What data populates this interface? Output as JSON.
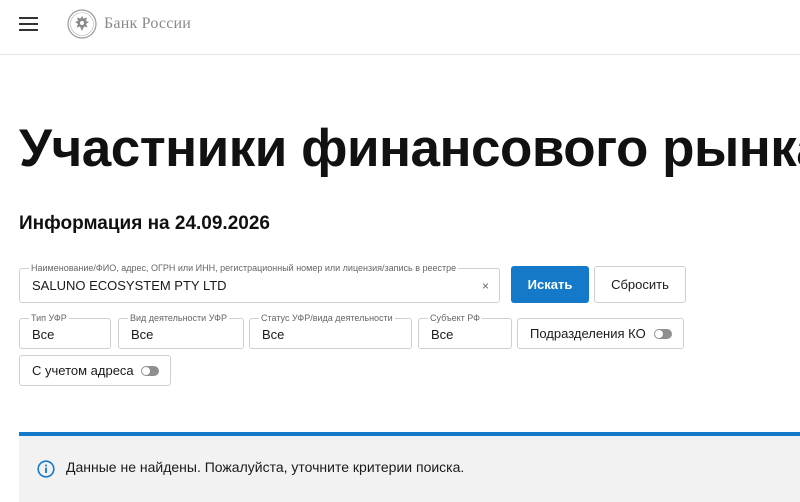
{
  "header": {
    "menu_icon": "hamburger-menu-icon",
    "logo_icon": "bank-of-russia-eagle-emblem",
    "logo_text": "Банк России"
  },
  "page": {
    "title": "Участники финансового рынка",
    "info_date": "Информация на 24.09.2026"
  },
  "search": {
    "label": "Наименование/ФИО, адрес, ОГРН или ИНН, регистрационный номер или лицензия/запись в реестре",
    "value": "SALUNO ECOSYSTEM PTY LTD",
    "clear_glyph": "×",
    "search_button": "Искать",
    "reset_button": "Сбросить"
  },
  "filters": [
    {
      "label": "Тип УФР",
      "value": "Все"
    },
    {
      "label": "Вид деятельности УФР",
      "value": "Все"
    },
    {
      "label": "Статус УФР/вида деятельности",
      "value": "Все"
    },
    {
      "label": "Субъект РФ",
      "value": "Все"
    }
  ],
  "toggles": {
    "subdivisions": {
      "label": "Подразделения КО",
      "on": false
    },
    "with_address": {
      "label": "С учетом адреса",
      "on": false
    }
  },
  "notice": {
    "icon": "info-circle-icon",
    "text": "Данные не найдены. Пожалуйста, уточните критерии поиска.",
    "accent_color": "#1479c9"
  },
  "colors": {
    "primary": "#1479c9",
    "toggle_off": "#8f8f8f"
  }
}
